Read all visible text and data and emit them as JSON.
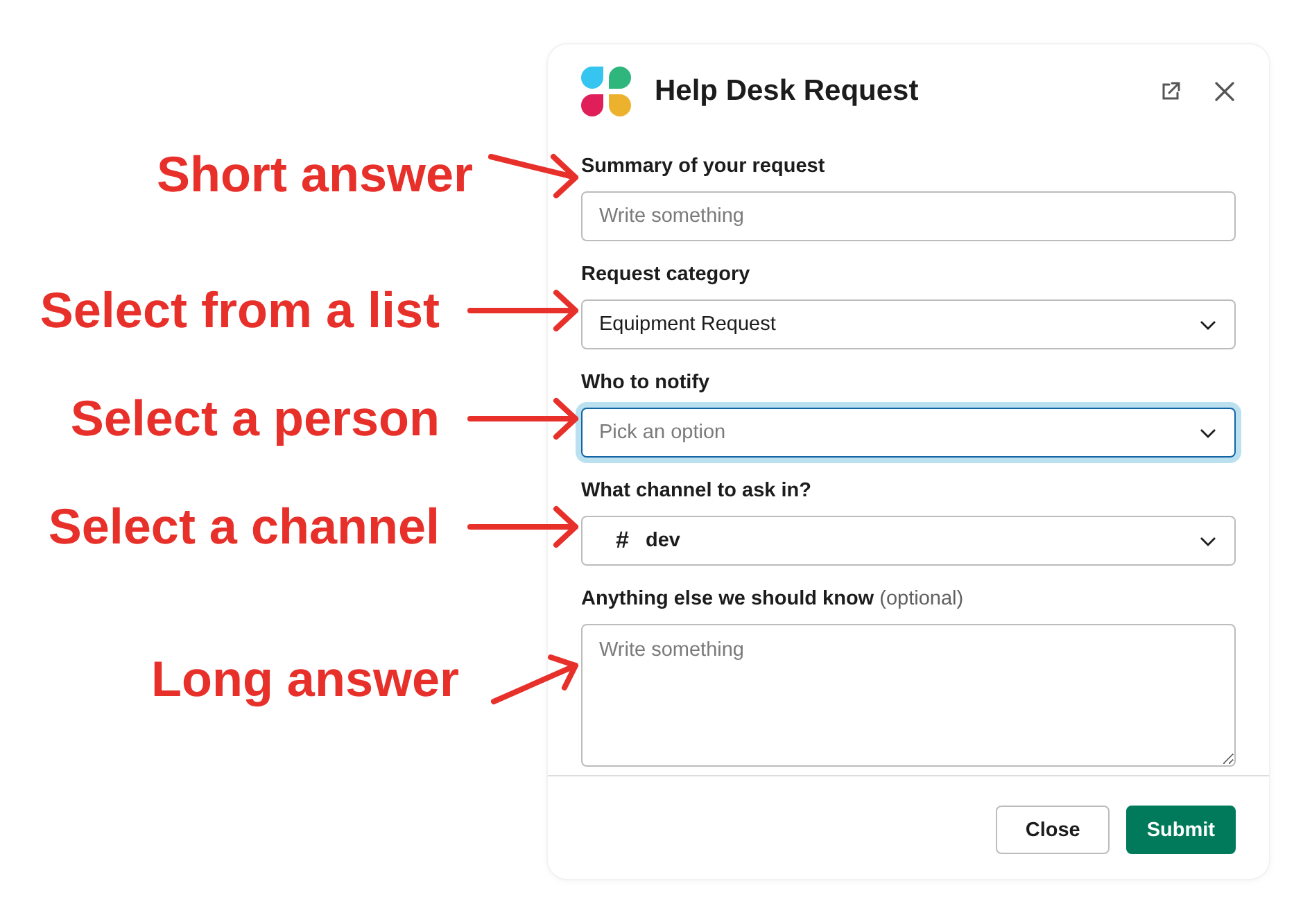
{
  "dialog": {
    "title": "Help Desk Request"
  },
  "fields": [
    {
      "kind": "text",
      "label": "Summary of your request",
      "placeholder": "Write something",
      "annotation": {
        "text": "Short answer",
        "kind": "down-right"
      }
    },
    {
      "kind": "select",
      "label": "Request category",
      "value": "Equipment Request",
      "focused": false,
      "annotation": {
        "text": "Select from a list",
        "kind": "right"
      }
    },
    {
      "kind": "select",
      "label": "Who to notify",
      "placeholder": "Pick an option",
      "focused": true,
      "annotation": {
        "text": "Select a person",
        "kind": "right"
      }
    },
    {
      "kind": "channel",
      "label": "What channel to ask in?",
      "prefix": "#",
      "value": "dev",
      "focused": false,
      "annotation": {
        "text": "Select a channel",
        "kind": "right"
      }
    },
    {
      "kind": "textarea",
      "label": "Anything else we should know",
      "hint": "(optional)",
      "placeholder": "Write something",
      "annotation": {
        "text": "Long answer",
        "kind": "up-right"
      }
    }
  ],
  "buttons": [
    {
      "label": "Close",
      "kind": "secondary"
    },
    {
      "label": "Submit",
      "kind": "primary"
    }
  ]
}
